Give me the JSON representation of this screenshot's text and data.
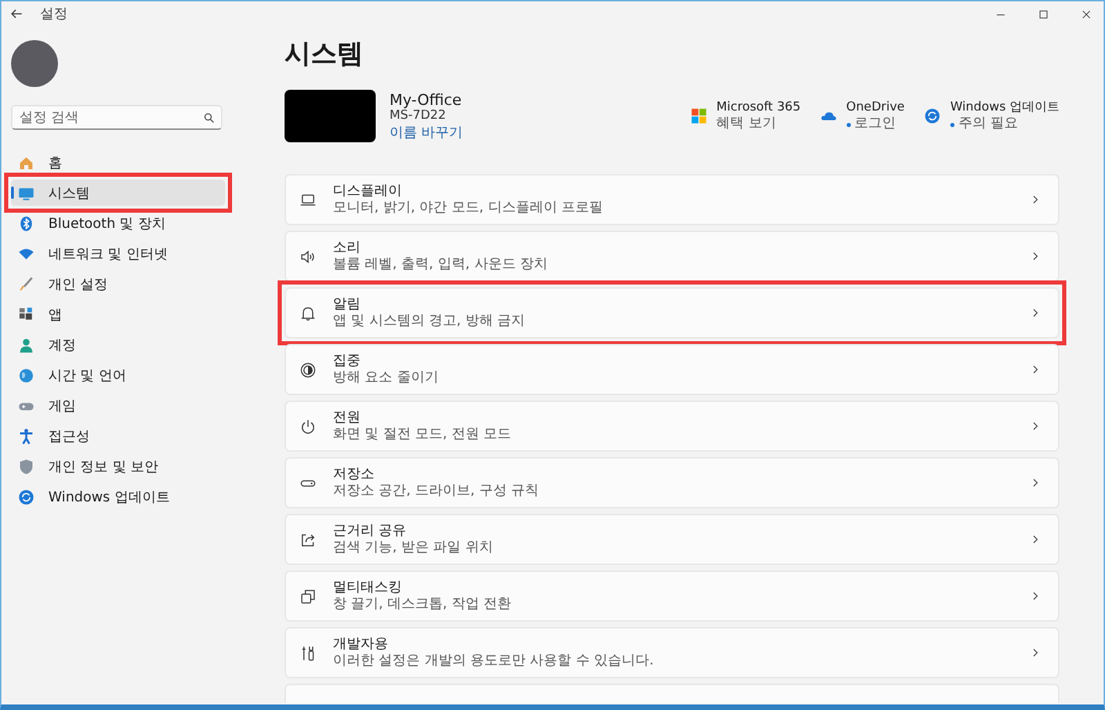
{
  "window": {
    "title": "설정"
  },
  "sidebar": {
    "search": {
      "placeholder": "설정 검색"
    },
    "items": [
      {
        "label": "홈",
        "kind": "home",
        "selected": false,
        "highlighted": false
      },
      {
        "label": "시스템",
        "kind": "system",
        "selected": true,
        "highlighted": true
      },
      {
        "label": "Bluetooth 및 장치",
        "kind": "bluetooth",
        "selected": false,
        "highlighted": false
      },
      {
        "label": "네트워크 및 인터넷",
        "kind": "network",
        "selected": false,
        "highlighted": false
      },
      {
        "label": "개인 설정",
        "kind": "brush",
        "selected": false,
        "highlighted": false
      },
      {
        "label": "앱",
        "kind": "apps",
        "selected": false,
        "highlighted": false
      },
      {
        "label": "계정",
        "kind": "account",
        "selected": false,
        "highlighted": false
      },
      {
        "label": "시간 및 언어",
        "kind": "globe",
        "selected": false,
        "highlighted": false
      },
      {
        "label": "게임",
        "kind": "gamepad",
        "selected": false,
        "highlighted": false
      },
      {
        "label": "접근성",
        "kind": "accessibility",
        "selected": false,
        "highlighted": false
      },
      {
        "label": "개인 정보 및 보안",
        "kind": "shield",
        "selected": false,
        "highlighted": false
      },
      {
        "label": "Windows 업데이트",
        "kind": "update",
        "selected": false,
        "highlighted": false
      }
    ]
  },
  "page": {
    "title": "시스템"
  },
  "device": {
    "name": "My-Office",
    "model": "MS-7D22",
    "rename_link": "이름 바꾸기"
  },
  "services": [
    {
      "kind": "tiles",
      "title": "Microsoft 365",
      "status": "혜택 보기",
      "bullet": false
    },
    {
      "kind": "cloud",
      "title": "OneDrive",
      "status": "로그인",
      "bullet": true
    },
    {
      "kind": "update",
      "title": "Windows 업데이트",
      "status": "주의 필요",
      "bullet": true
    }
  ],
  "settings": [
    {
      "kind": "display",
      "title": "디스플레이",
      "subtitle": "모니터, 밝기, 야간 모드, 디스플레이 프로필",
      "highlighted": false
    },
    {
      "kind": "speaker",
      "title": "소리",
      "subtitle": "볼륨 레벨, 출력, 입력, 사운드 장치",
      "highlighted": false
    },
    {
      "kind": "bell",
      "title": "알림",
      "subtitle": "앱 및 시스템의 경고, 방해 금지",
      "highlighted": true
    },
    {
      "kind": "focus",
      "title": "집중",
      "subtitle": "방해 요소 줄이기",
      "highlighted": false
    },
    {
      "kind": "power",
      "title": "전원",
      "subtitle": "화면 및 절전 모드, 전원 모드",
      "highlighted": false
    },
    {
      "kind": "storage",
      "title": "저장소",
      "subtitle": "저장소 공간, 드라이브, 구성 규칙",
      "highlighted": false
    },
    {
      "kind": "share",
      "title": "근거리 공유",
      "subtitle": "검색 기능, 받은 파일 위치",
      "highlighted": false
    },
    {
      "kind": "windows",
      "title": "멀티태스킹",
      "subtitle": "창 끌기, 데스크톱, 작업 전환",
      "highlighted": false
    },
    {
      "kind": "tools",
      "title": "개발자용",
      "subtitle": "이러한 설정은 개발의 용도로만 사용할 수 있습니다.",
      "highlighted": false
    }
  ]
}
